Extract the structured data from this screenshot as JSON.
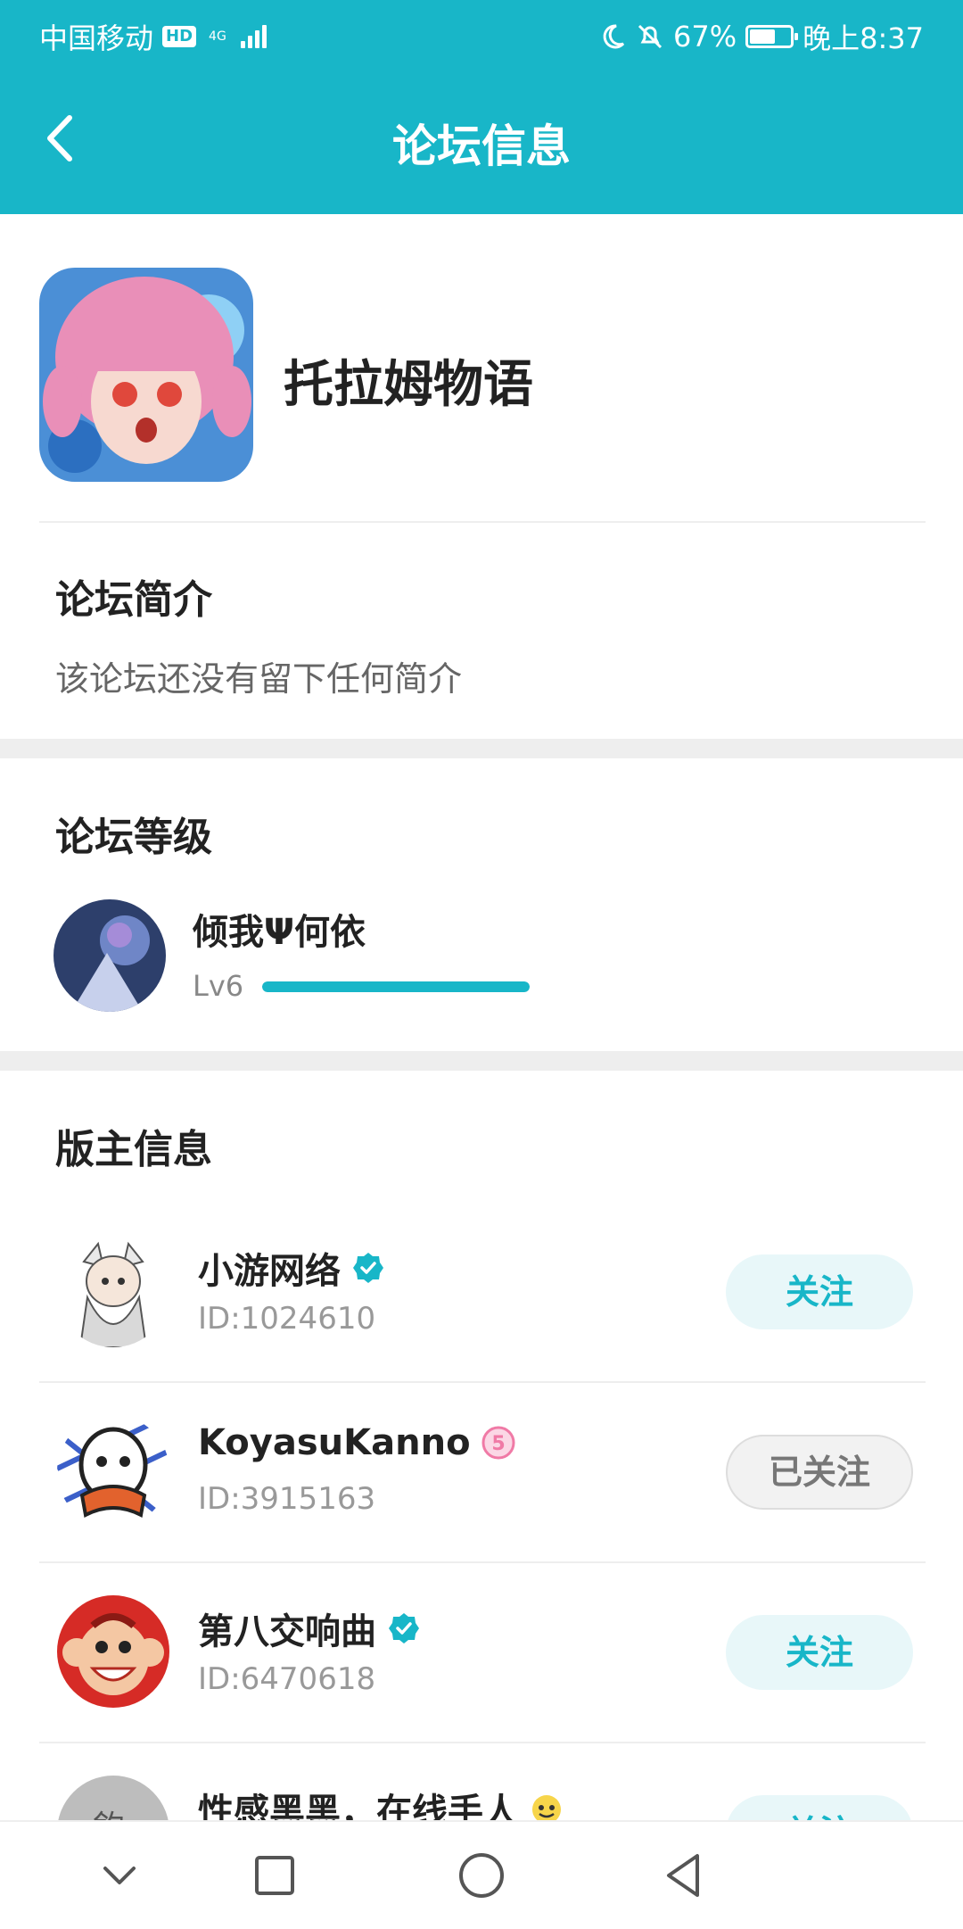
{
  "status_bar": {
    "carrier": "中国移动",
    "hd": "HD",
    "network": "4G",
    "battery": "67%",
    "battery_level": 0.67,
    "time": "晚上8:37"
  },
  "header": {
    "title": "论坛信息"
  },
  "forum": {
    "name": "托拉姆物语"
  },
  "intro": {
    "title": "论坛简介",
    "text": "该论坛还没有留下任何简介"
  },
  "level": {
    "title": "论坛等级",
    "user_name": "倾我Ψ何依",
    "level_label": "Lv6",
    "progress": 1.0
  },
  "moderators": {
    "title": "版主信息",
    "items": [
      {
        "name": "小游网络",
        "id": "ID:1024610",
        "badge": "verified-icon",
        "button": "关注"
      },
      {
        "name": "KoyasuKanno",
        "id": "ID:3915163",
        "badge": "level-badge-icon",
        "button": "已关注"
      },
      {
        "name": "第八交响曲",
        "id": "ID:6470618",
        "badge": "verified-icon",
        "button": "关注"
      },
      {
        "name": "性感黑黑，在线手人",
        "badge": "emoji-icon",
        "button": "关注"
      }
    ]
  },
  "colors": {
    "accent": "#18b6c8",
    "follow_bg": "#e8f7f9",
    "divider": "#eeeeee",
    "secondary_text": "#999999"
  }
}
